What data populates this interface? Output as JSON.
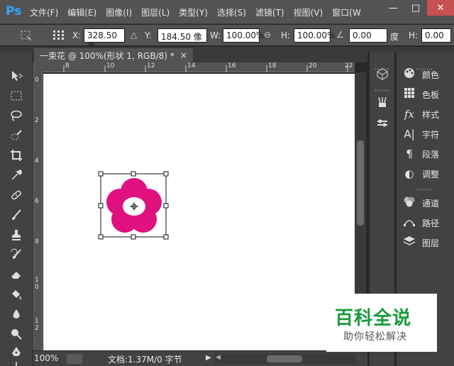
{
  "app": {
    "logo": "Ps"
  },
  "menu": [
    "文件(F)",
    "编辑(E)",
    "图像(I)",
    "图层(L)",
    "类型(Y)",
    "选择(S)",
    "滤镜(T)",
    "视图(V)",
    "窗口(W"
  ],
  "window_controls": {
    "minimize": "—",
    "maximize": "□",
    "close": "✕"
  },
  "options": {
    "x_label": "X:",
    "x_value": "328.50 像",
    "y_label": "Y:",
    "y_value": "184.50 像",
    "w_label": "W:",
    "w_value": "100.00%",
    "h_label": "H:",
    "h_value": "100.00%",
    "angle_value": "0.00",
    "angle_unit": "度",
    "h2_label": "H:",
    "h2_value": "0.00"
  },
  "document": {
    "tab_title": "一束花 @ 100%(形状 1, RGB/8) *",
    "tab_close": "×"
  },
  "ruler": {
    "top_ticks": [
      "8",
      "10",
      "12",
      "14",
      "16",
      "18",
      "20",
      "22"
    ],
    "left_ticks": [
      "0",
      "2",
      "4",
      "6",
      "8",
      "1\n0",
      "1\n2"
    ]
  },
  "status": {
    "zoom": "100%",
    "info": "文档:1.37M/0 字节"
  },
  "panels": [
    {
      "icon": "palette-icon",
      "glyph": "🎨",
      "label": "颜色"
    },
    {
      "icon": "swatches-icon",
      "glyph": "▦",
      "label": "色板"
    },
    {
      "icon": "styles-icon",
      "glyph": "fx",
      "label": "样式"
    },
    {
      "icon": "character-icon",
      "glyph": "A|",
      "label": "字符"
    },
    {
      "icon": "paragraph-icon",
      "glyph": "¶",
      "label": "段落"
    },
    {
      "icon": "adjustments-icon",
      "glyph": "◐",
      "label": "调整"
    },
    {
      "icon": "channels-icon",
      "glyph": "◈",
      "label": "通道"
    },
    {
      "icon": "paths-icon",
      "glyph": "⌘",
      "label": "路径"
    },
    {
      "icon": "layers-icon",
      "glyph": "◆",
      "label": "图层"
    }
  ],
  "watermark": {
    "title": "百科全说",
    "subtitle": "助你轻松解决"
  },
  "colors": {
    "flower": "#e0117f",
    "ui_dark": "#424242",
    "menubar": "#535353",
    "watermark_green": "#1a9a3c"
  }
}
